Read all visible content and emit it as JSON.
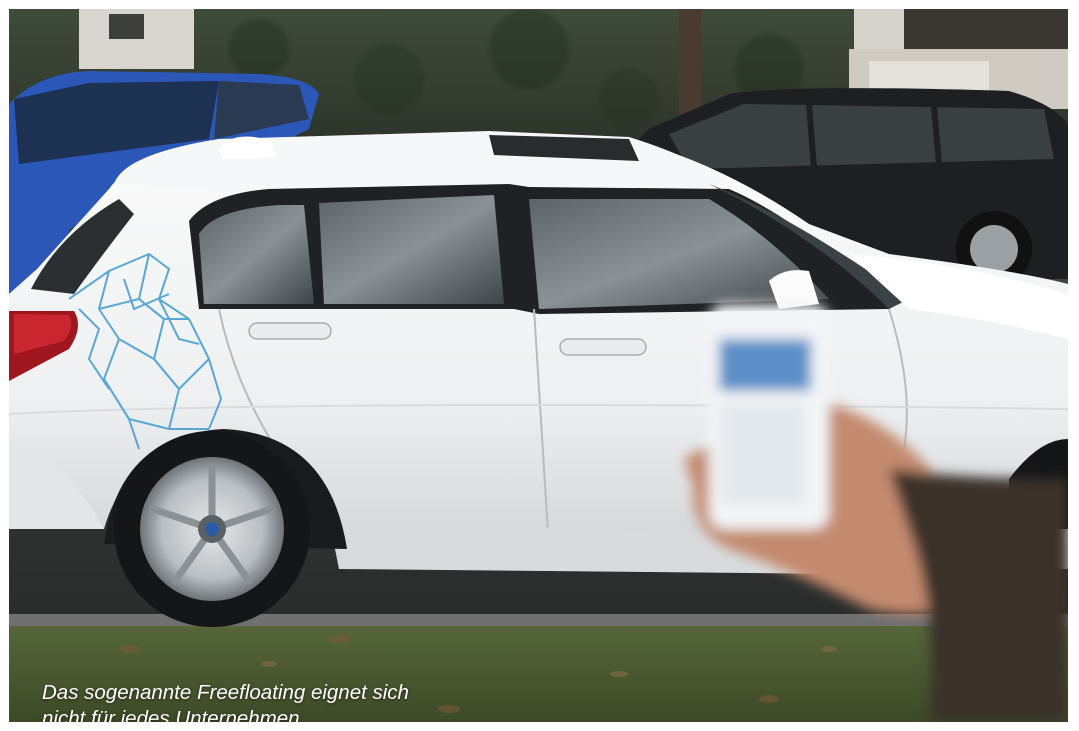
{
  "photo": {
    "subject": "white-carsharing-hatchback-with-phone",
    "caption_lines": [
      "Das sogenannte Freefloating eignet sich",
      "nicht für jedes Unternehmen"
    ]
  },
  "colors": {
    "car_body": "#f2f3f4",
    "hedge": "#2f3b2c",
    "blue_car": "#2a57b8",
    "dark_car": "#1e1f22",
    "decal": "#4a9fd2",
    "grass": "#4a5a2e",
    "caption_text": "#ffffff"
  }
}
